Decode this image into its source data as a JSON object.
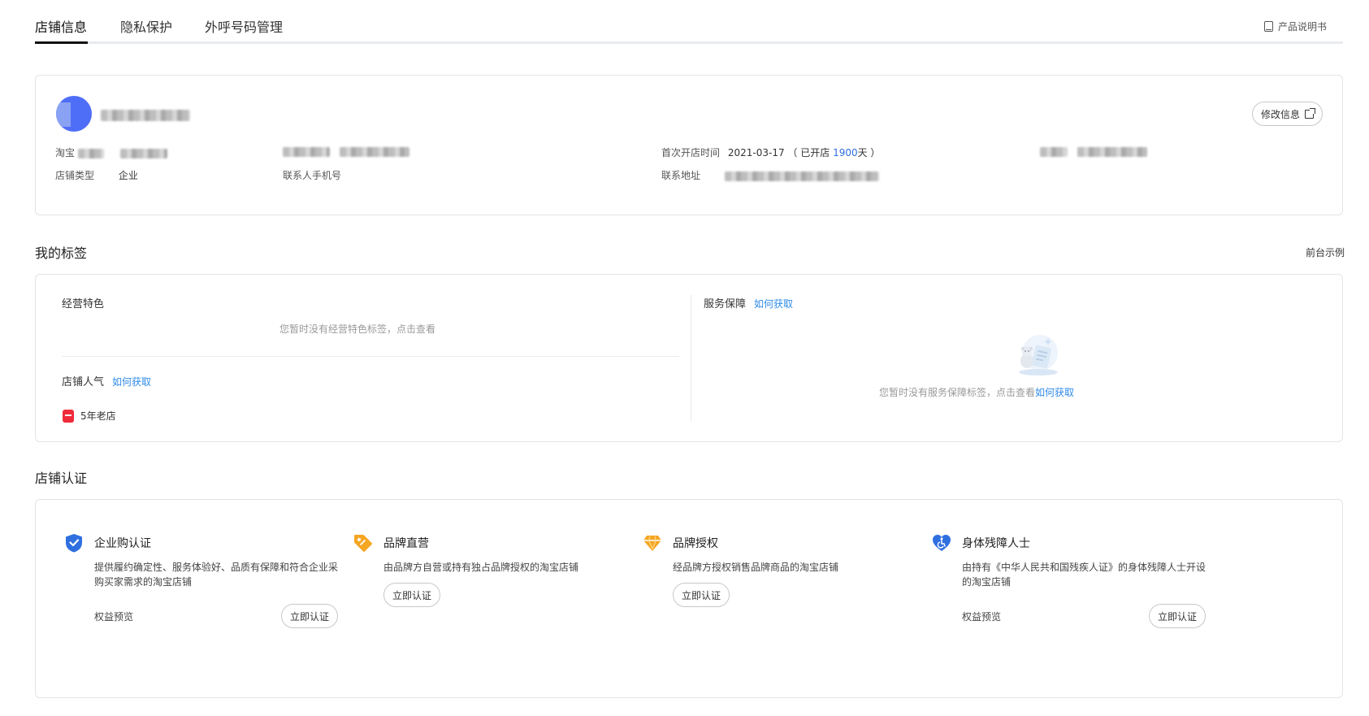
{
  "tabs": [
    {
      "label": "店铺信息"
    },
    {
      "label": "隐私保护"
    },
    {
      "label": "外呼号码管理"
    }
  ],
  "doc_link": {
    "label": "产品说明书"
  },
  "store": {
    "edit_label": "修改信息",
    "taobao_label": "淘宝",
    "store_type_label": "店铺类型",
    "store_type_value": "企业",
    "contact_phone_label": "联系人手机号",
    "first_open_label": "首次开店时间",
    "first_open_date": "2021-03-17",
    "open_prefix": "（ 已开店 ",
    "open_days": "1900",
    "open_suffix": "天 ）",
    "address_label": "联系地址"
  },
  "tags": {
    "section_title": "我的标签",
    "frontend_example": "前台示例",
    "business_title": "经营特色",
    "business_empty": "您暂时没有经营特色标签，点击查看",
    "popularity_title": "店铺人气",
    "how_to_get": "如何获取",
    "old_store": "5年老店",
    "service_title": "服务保障",
    "service_empty": "您暂时没有服务保障标签，点击查看",
    "service_empty_link": "如何获取"
  },
  "certification": {
    "section_title": "店铺认证",
    "items": [
      {
        "title": "企业购认证",
        "desc": "提供履约确定性、服务体验好、品质有保障和符合企业采购买家需求的淘宝店铺",
        "benefit": "权益预览",
        "button": "立即认证",
        "color": "#2f6fe0"
      },
      {
        "title": "品牌直营",
        "desc": "由品牌方自营或持有独占品牌授权的淘宝店铺",
        "benefit": "",
        "button": "立即认证",
        "color": "#f5a623"
      },
      {
        "title": "品牌授权",
        "desc": "经品牌方授权销售品牌商品的淘宝店铺",
        "benefit": "",
        "button": "立即认证",
        "color": "#f5a623"
      },
      {
        "title": "身体残障人士",
        "desc": "由持有《中华人民共和国残疾人证》的身体残障人士开设的淘宝店铺",
        "benefit": "权益预览",
        "button": "立即认证",
        "color": "#2f6fe0"
      }
    ]
  }
}
